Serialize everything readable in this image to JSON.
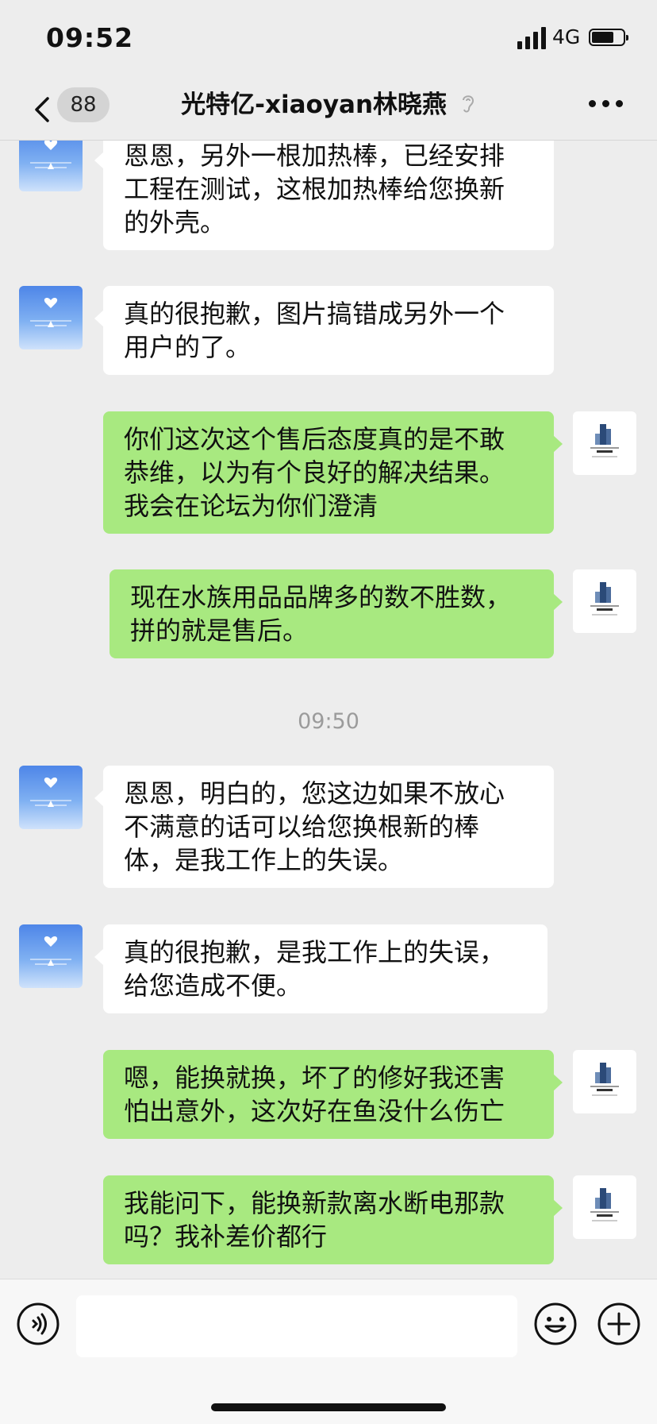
{
  "status_bar": {
    "time": "09:52",
    "network": "4G",
    "battery_level": 0.7
  },
  "nav": {
    "unread_count": "88",
    "title": "光特亿-xiaoyan林晓燕"
  },
  "messages": [
    {
      "side": "left",
      "lines": [
        "恩恩，另外一根加热棒，已经安排",
        "工程在测试，这根加热棒给您换新",
        "的外壳。"
      ]
    },
    {
      "side": "left",
      "lines": [
        "真的很抱歉，图片搞错成另外一个",
        "用户的了。"
      ]
    },
    {
      "side": "right",
      "lines": [
        "你们这次这个售后态度真的是不敢",
        "恭维，以为有个良好的解决结果。",
        "我会在论坛为你们澄清"
      ]
    },
    {
      "side": "right",
      "lines": [
        "现在水族用品品牌多的数不胜数，",
        "拼的就是售后。"
      ]
    },
    {
      "time": "09:50"
    },
    {
      "side": "left",
      "lines": [
        "恩恩，明白的，您这边如果不放心",
        "不满意的话可以给您换根新的棒",
        "体，是我工作上的失误。"
      ]
    },
    {
      "side": "left",
      "lines": [
        "真的很抱歉，是我工作上的失误，",
        "给您造成不便。"
      ]
    },
    {
      "side": "right",
      "lines": [
        "嗯，能换就换，坏了的修好我还害",
        "怕出意外，这次好在鱼没什么伤亡"
      ]
    },
    {
      "side": "right",
      "lines": [
        "我能问下，能换新款离水断电那款",
        "吗？我补差价都行"
      ]
    }
  ],
  "composer": {
    "input_value": ""
  },
  "icons": {
    "back": "chevron-left-icon",
    "ear": "ear-icon",
    "more": "more-dots-icon",
    "voice": "voice-icon",
    "emoji": "emoji-icon",
    "plus": "plus-icon"
  },
  "colors": {
    "background": "#ededed",
    "incoming_bubble": "#ffffff",
    "outgoing_bubble": "#a8e980"
  }
}
